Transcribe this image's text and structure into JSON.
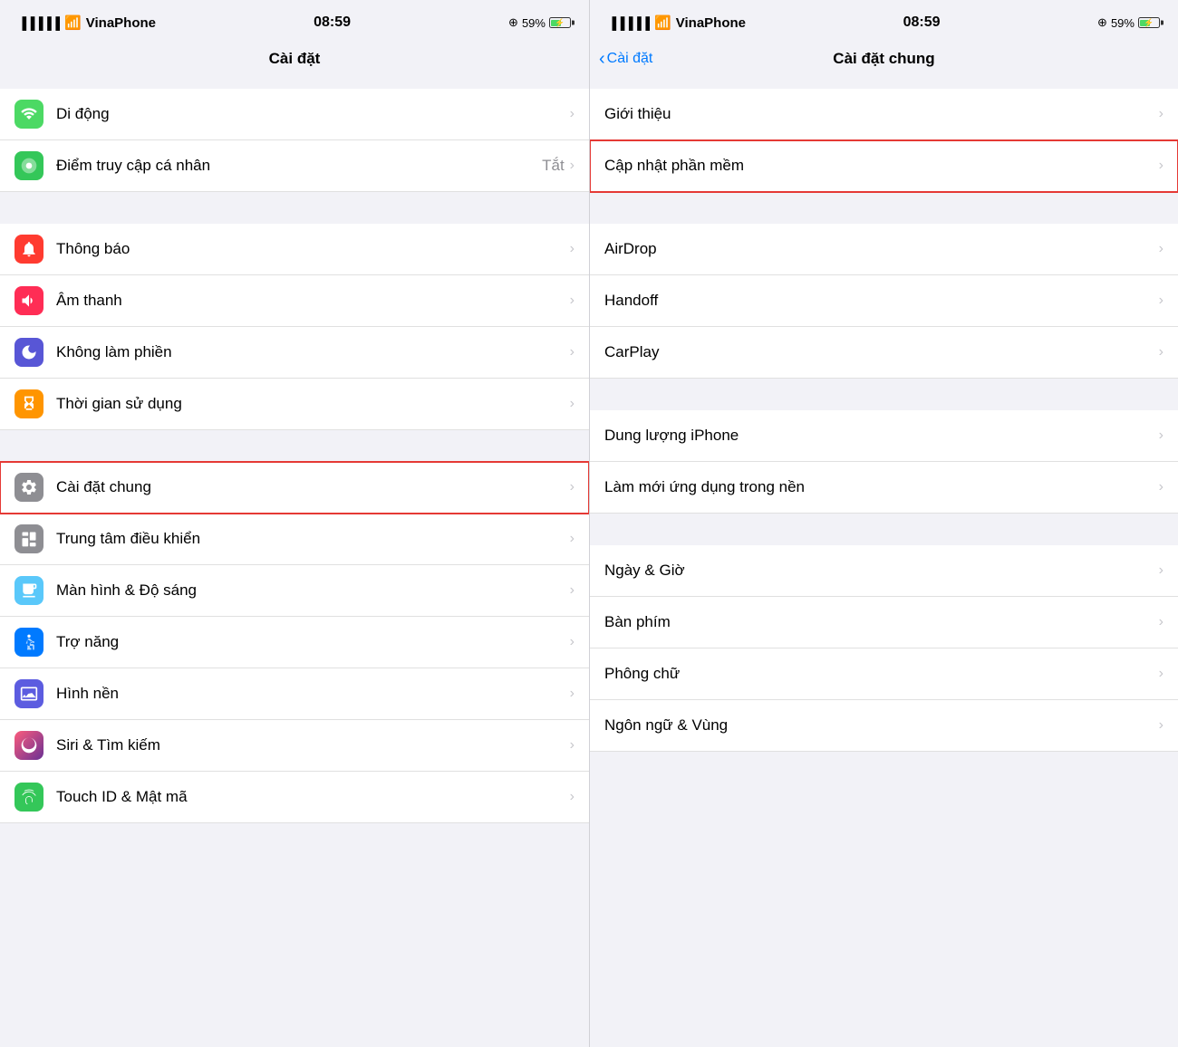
{
  "left_panel": {
    "status": {
      "carrier": "VinaPhone",
      "time": "08:59",
      "battery": "59%"
    },
    "title": "Cài đặt",
    "sections": [
      {
        "items": [
          {
            "id": "di-dong",
            "label": "Di động",
            "icon_color": "green",
            "icon": "signal"
          },
          {
            "id": "diem-truy-cap",
            "label": "Điểm truy cập cá nhân",
            "subtext": "Tắt",
            "icon_color": "green2",
            "icon": "link"
          }
        ]
      },
      {
        "items": [
          {
            "id": "thong-bao",
            "label": "Thông báo",
            "icon_color": "red",
            "icon": "bell"
          },
          {
            "id": "am-thanh",
            "label": "Âm thanh",
            "icon_color": "pink",
            "icon": "sound"
          },
          {
            "id": "khong-lam-phien",
            "label": "Không làm phiền",
            "icon_color": "purple",
            "icon": "moon"
          },
          {
            "id": "thoi-gian",
            "label": "Thời gian sử dụng",
            "icon_color": "orange",
            "icon": "hourglass"
          }
        ]
      },
      {
        "items": [
          {
            "id": "cai-dat-chung",
            "label": "Cài đặt chung",
            "icon_color": "gray",
            "icon": "gear",
            "highlighted": true
          },
          {
            "id": "trung-tam",
            "label": "Trung tâm điều khiển",
            "icon_color": "gray",
            "icon": "controls"
          },
          {
            "id": "man-hinh",
            "label": "Màn hình & Độ sáng",
            "icon_color": "blue2",
            "icon": "display"
          },
          {
            "id": "tro-nang",
            "label": "Trợ năng",
            "icon_color": "blue",
            "icon": "accessibility"
          },
          {
            "id": "hinh-nen",
            "label": "Hình nền",
            "icon_color": "indigo",
            "icon": "wallpaper"
          },
          {
            "id": "siri",
            "label": "Siri & Tìm kiếm",
            "icon_color": "gradient-pink",
            "icon": "siri"
          },
          {
            "id": "touch-id",
            "label": "Touch ID & Mật mã",
            "icon_color": "green2",
            "icon": "fingerprint"
          }
        ]
      }
    ]
  },
  "right_panel": {
    "status": {
      "carrier": "VinaPhone",
      "time": "08:59",
      "battery": "59%"
    },
    "back_label": "Cài đặt",
    "title": "Cài đặt chung",
    "sections": [
      {
        "items": [
          {
            "id": "gioi-thieu",
            "label": "Giới thiệu"
          },
          {
            "id": "cap-nhat",
            "label": "Cập nhật phần mềm",
            "highlighted": true
          }
        ]
      },
      {
        "items": [
          {
            "id": "airdrop",
            "label": "AirDrop"
          },
          {
            "id": "handoff",
            "label": "Handoff"
          },
          {
            "id": "carplay",
            "label": "CarPlay"
          }
        ]
      },
      {
        "items": [
          {
            "id": "dung-luong",
            "label": "Dung lượng iPhone"
          },
          {
            "id": "lam-moi",
            "label": "Làm mới ứng dụng trong nền"
          }
        ]
      },
      {
        "items": [
          {
            "id": "ngay-gio",
            "label": "Ngày & Giờ"
          },
          {
            "id": "ban-phim",
            "label": "Bàn phím"
          },
          {
            "id": "phong-chu",
            "label": "Phông chữ"
          },
          {
            "id": "ngon-ngu",
            "label": "Ngôn ngữ & Vùng"
          }
        ]
      }
    ]
  }
}
